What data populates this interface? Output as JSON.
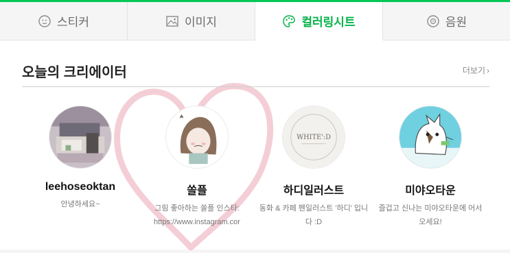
{
  "tabs": [
    {
      "label": "스티커",
      "icon": "sticker-icon",
      "active": false
    },
    {
      "label": "이미지",
      "icon": "image-icon",
      "active": false
    },
    {
      "label": "컬러링시트",
      "icon": "palette-icon",
      "active": true
    },
    {
      "label": "음원",
      "icon": "music-icon",
      "active": false
    }
  ],
  "section": {
    "title": "오늘의 크리에이터",
    "more_label": "더보기",
    "more_icon": "chevron-right-icon"
  },
  "creators": [
    {
      "name": "leehoseoktan",
      "desc": "안녕하세요~"
    },
    {
      "name": "쏠플",
      "desc": "그림 좋아하는 쏠플 인스타: https://www.instagram.cor"
    },
    {
      "name": "하디일러스트",
      "desc": "동화 & 카페 펜일러스트 '하디' 입니다 :D",
      "avatar_text": "WHITE':D"
    },
    {
      "name": "미야오타운",
      "desc": "즐겁고 신나는 미야오타운에 어서 오세요!"
    }
  ],
  "colors": {
    "accent": "#06c755",
    "active_tab_text": "#06b34a",
    "heart": "#f2c6cf"
  }
}
